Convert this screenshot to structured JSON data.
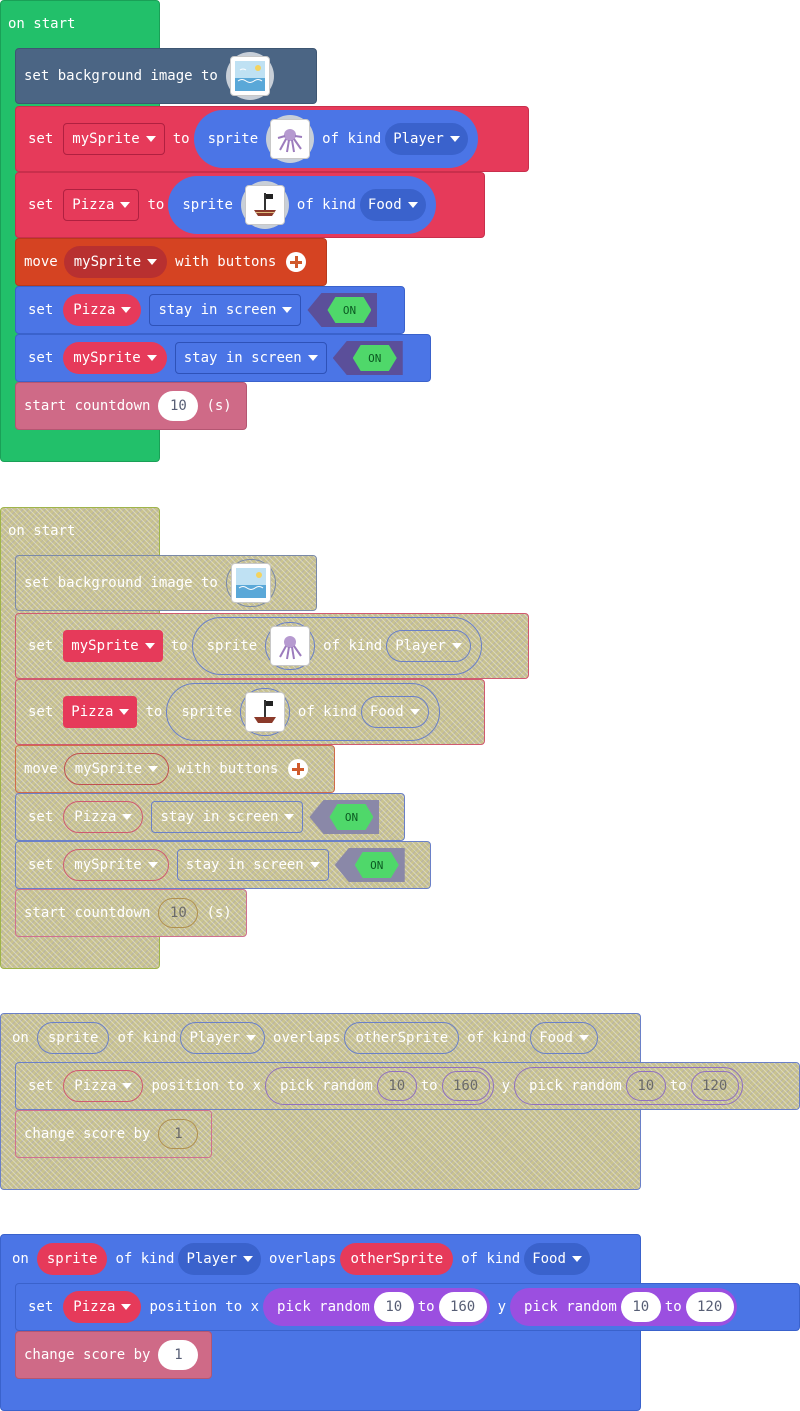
{
  "common": {
    "on_start": "on start",
    "set": "set",
    "to": "to",
    "sprite": "sprite",
    "of_kind": "of kind",
    "move": "move",
    "with_buttons": "with buttons",
    "stay_in_screen": "stay in screen",
    "on_toggle": "ON",
    "start_countdown": "start countdown",
    "seconds_unit": "(s)",
    "set_background_image_to": "set background image to",
    "on": "on",
    "overlaps": "overlaps",
    "position_to_x": "position to x",
    "pick_random": "pick random",
    "y": "y",
    "change_score_by": "change score by"
  },
  "stack1": {
    "var_mysprite": "mySprite",
    "var_pizza": "Pizza",
    "kind_player": "Player",
    "kind_food": "Food",
    "countdown_value": "10"
  },
  "stack2": {
    "var_mysprite": "mySprite",
    "var_pizza": "Pizza",
    "kind_player": "Player",
    "kind_food": "Food",
    "countdown_value": "10"
  },
  "stack3": {
    "sprite_param": "sprite",
    "kind_player": "Player",
    "other_param": "otherSprite",
    "kind_food": "Food",
    "var_pizza": "Pizza",
    "x_min": "10",
    "x_max": "160",
    "y_min": "10",
    "y_max": "120",
    "score_delta": "1"
  },
  "stack4": {
    "sprite_param": "sprite",
    "kind_player": "Player",
    "other_param": "otherSprite",
    "kind_food": "Food",
    "var_pizza": "Pizza",
    "x_min": "10",
    "x_max": "160",
    "y_min": "10",
    "y_max": "120",
    "score_delta": "1"
  },
  "colors": {
    "event_green": "#22c06a",
    "scene_slate": "#4b6584",
    "sprites_red": "#e63a5a",
    "controller_orange": "#d54322",
    "sprites_blue": "#4b75e6",
    "info_pink": "#cf6a87",
    "math_purple": "#9b4fe0",
    "disabled_olive": "#c9c38f"
  },
  "icons": {
    "background": "ocean-scene-icon",
    "player_sprite": "octopus-icon",
    "food_sprite": "pirate-ship-icon"
  }
}
